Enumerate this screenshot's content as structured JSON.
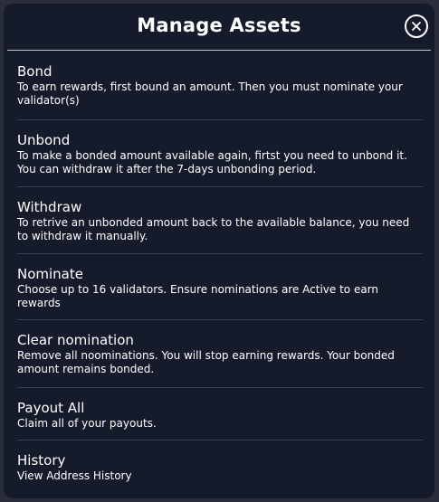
{
  "modal": {
    "title": "Manage Assets",
    "close_icon": "close-icon"
  },
  "items": [
    {
      "title": "Bond",
      "description": "To earn rewards, first bound an amount. Then you must nominate your validator(s)"
    },
    {
      "title": "Unbond",
      "description": "To make a bonded amount available again, firtst you need to unbond it. You can withdraw it after the 7-days unbonding period."
    },
    {
      "title": "Withdraw",
      "description": "To retrive an unbonded amount back to the available balance, you need to withdraw it manually."
    },
    {
      "title": "Nominate",
      "description": "Choose up to 16 validators. Ensure nominations are Active to earn rewards"
    },
    {
      "title": "Clear nomination",
      "description": "Remove all noominations. You will stop earning rewards. Your bonded amount remains bonded."
    },
    {
      "title": "Payout All",
      "description": "Claim all of your payouts."
    },
    {
      "title": "History",
      "description": "View Address History"
    }
  ],
  "colors": {
    "modal_bg": "#161b2b",
    "text": "#ffffff",
    "divider": "#3a3f4e"
  }
}
